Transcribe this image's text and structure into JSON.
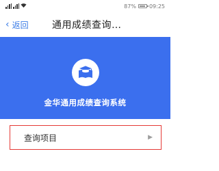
{
  "status_bar": {
    "battery": "87%",
    "time": "09:25",
    "battery_level": 0.87
  },
  "nav": {
    "back_label": "返回",
    "title": "通用成绩查询…"
  },
  "hero": {
    "system_title": "金华通用成绩查询系统",
    "icon": "graduation-cap-book-icon"
  },
  "menu": {
    "items": [
      {
        "label": "查询项目"
      }
    ]
  },
  "colors": {
    "accent": "#3b6fee",
    "highlight_border": "#e53935"
  }
}
